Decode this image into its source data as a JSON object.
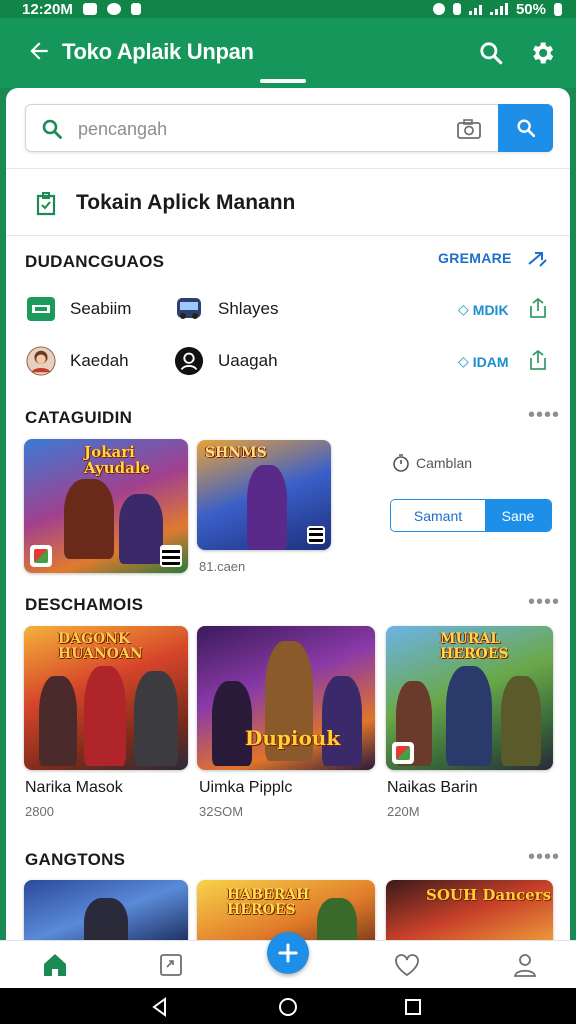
{
  "status_bar": {
    "time": "12:20M",
    "battery": "50%"
  },
  "app_bar": {
    "title": "Toko Aplaik Unpan"
  },
  "search": {
    "placeholder": "pencangah"
  },
  "store_header": {
    "title": "Tokain Aplick Manann"
  },
  "downloads": {
    "title": "DUDANCGUAOS",
    "link": "GREMARE",
    "items": [
      {
        "label": "Seabiim",
        "icon": "card-icon"
      },
      {
        "label": "Shlayes",
        "icon": "bus-icon"
      },
      {
        "label": "Kaedah",
        "icon": "avatar-icon"
      },
      {
        "label": "Uaagah",
        "icon": "profile-circle-icon"
      }
    ],
    "tags": [
      "MDIK",
      "IDAM"
    ]
  },
  "categories": {
    "title": "CATAGUIDIN",
    "games": [
      {
        "art_title": "Jokari Ayudale",
        "size": ""
      },
      {
        "art_title": "SHNMS",
        "size": "81.caen"
      }
    ],
    "countdown": "Camblan",
    "segment": {
      "left": "Samant",
      "right": "Sane"
    }
  },
  "discover": {
    "title": "DESCHAMOIS",
    "apps": [
      {
        "art_title": "DAGONK HUANOAN",
        "name": "Narika Masok",
        "size": "2800"
      },
      {
        "art_title": "Dupiouk",
        "name": "Uimka Pipplc",
        "size": "32SOM"
      },
      {
        "art_title": "MURAL HEROES",
        "name": "Naikas Barin",
        "size": "220M"
      }
    ]
  },
  "trending": {
    "title": "GANGTONS",
    "games": [
      {
        "art_title": ""
      },
      {
        "art_title": "HABERAH HEROES"
      },
      {
        "art_title": "SOUH Dancers"
      }
    ]
  },
  "colors": {
    "primary": "#15965a",
    "accent": "#1e8fe8"
  }
}
